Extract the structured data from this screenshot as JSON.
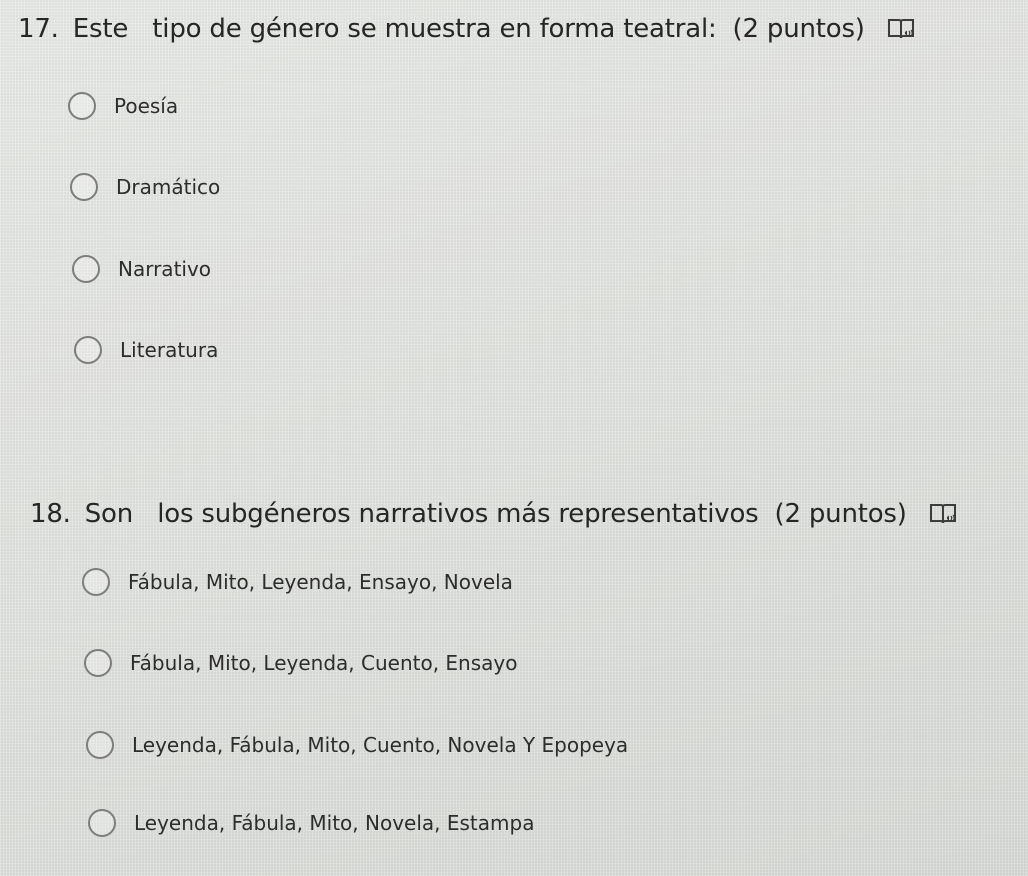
{
  "questions": [
    {
      "number": "17.",
      "text": "Este   tipo de género se muestra en forma teatral:",
      "points": "(2 puntos)",
      "reader_icon": "immersive-reader-icon",
      "options": [
        "Poesía",
        "Dramático",
        "Narrativo",
        "Literatura"
      ]
    },
    {
      "number": "18.",
      "text": "Son   los subgéneros narrativos más representativos",
      "points": "(2 puntos)",
      "reader_icon": "immersive-reader-icon",
      "options": [
        "Fábula, Mito, Leyenda, Ensayo, Novela",
        "Fábula, Mito, Leyenda, Cuento, Ensayo",
        "Leyenda, Fábula, Mito, Cuento, Novela Y Epopeya",
        "Leyenda, Fábula, Mito, Novela, Estampa"
      ]
    }
  ]
}
